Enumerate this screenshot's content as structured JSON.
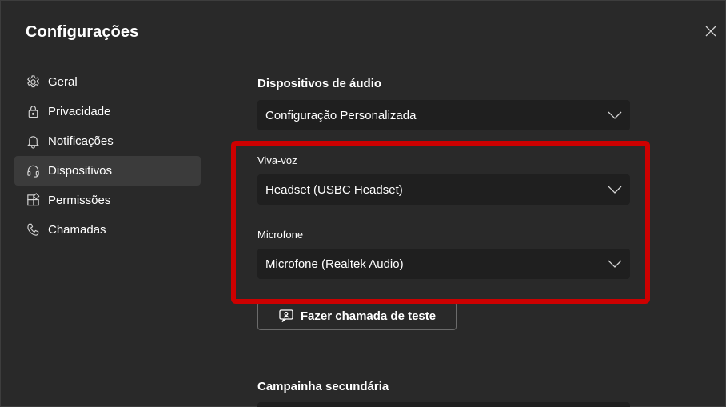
{
  "dialog": {
    "title": "Configurações"
  },
  "sidebar": {
    "items": [
      {
        "label": "Geral",
        "icon": "gear-icon"
      },
      {
        "label": "Privacidade",
        "icon": "lock-icon"
      },
      {
        "label": "Notificações",
        "icon": "bell-icon"
      },
      {
        "label": "Dispositivos",
        "icon": "headset-icon",
        "active": true
      },
      {
        "label": "Permissões",
        "icon": "apps-icon"
      },
      {
        "label": "Chamadas",
        "icon": "phone-icon"
      }
    ]
  },
  "audio": {
    "section_title": "Dispositivos de áudio",
    "preset_value": "Configuração Personalizada",
    "speaker_label": "Viva-voz",
    "speaker_value": "Headset (USBC Headset)",
    "mic_label": "Microfone",
    "mic_value": "Microfone (Realtek Audio)",
    "test_call_label": "Fazer chamada de teste"
  },
  "secondary_ringer": {
    "section_title": "Campainha secundária"
  },
  "colors": {
    "background": "#292929",
    "select_background": "#1f1f1f",
    "active_nav": "#3b3b3b",
    "highlight": "#cc0000"
  }
}
